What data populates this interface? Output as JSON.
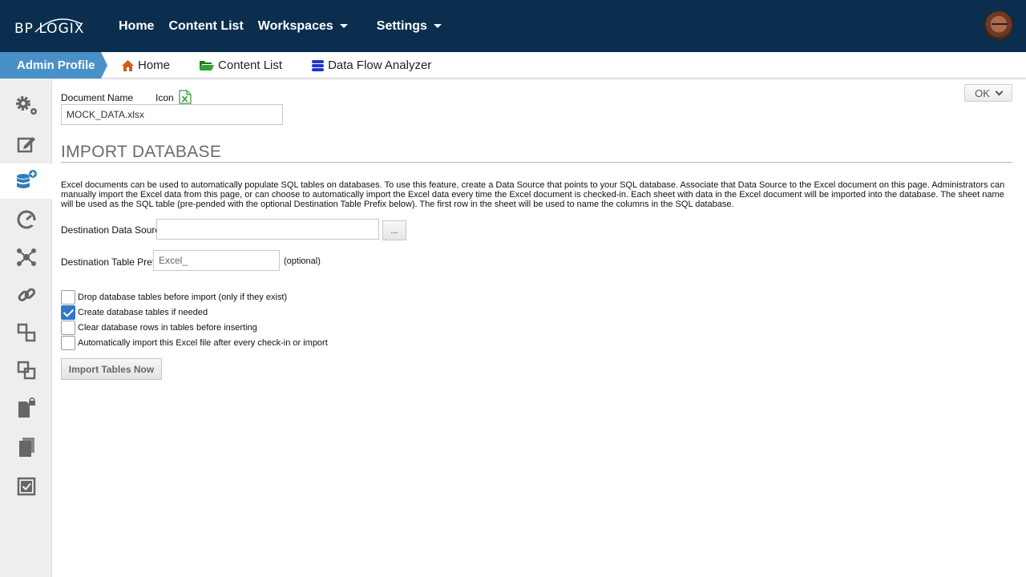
{
  "app": {
    "logo_text": "BP LOGIX",
    "top_nav": [
      {
        "label": "Home"
      },
      {
        "label": "Content List"
      },
      {
        "label": "Workspaces"
      },
      {
        "label": "Settings"
      }
    ]
  },
  "subbar": {
    "active": "Admin Profile",
    "links": [
      {
        "label": "Home",
        "icon": "house-icon",
        "color": "#c8621b"
      },
      {
        "label": "Content List",
        "icon": "folder-open-icon",
        "color": "#2a8a2a"
      },
      {
        "label": "Data Flow Analyzer",
        "icon": "database-stack-icon",
        "color": "#2233cc"
      }
    ]
  },
  "sidebar": {
    "items": [
      {
        "icon": "gears-icon"
      },
      {
        "icon": "edit-icon"
      },
      {
        "icon": "database-add-icon",
        "active": true
      },
      {
        "icon": "dashboard-gauge-icon"
      },
      {
        "icon": "network-icon"
      },
      {
        "icon": "link-icon"
      },
      {
        "icon": "dependencies-icon"
      },
      {
        "icon": "copy-link-icon"
      },
      {
        "icon": "locked-document-icon"
      },
      {
        "icon": "documents-icon"
      },
      {
        "icon": "checklist-icon"
      }
    ]
  },
  "form": {
    "document_name_label": "Document Name",
    "icon_label": "Icon",
    "document_name_value": "MOCK_DATA.xlsx",
    "ok_label": "OK",
    "section_title": "IMPORT DATABASE",
    "description": "Excel documents can be used to automatically populate SQL tables on databases. To use this feature, create a Data Source that points to your SQL database. Associate that Data Source to the Excel document on this page. Administrators can manually import the Excel data from this page, or can choose to automatically import the Excel data every time the Excel document is checked-in. Each sheet with data in the Excel document will be imported into the database. The sheet name will be used as the SQL table (pre-pended with the optional Destination Table Prefix below). The first row in the sheet will be used to name the columns in the SQL database.",
    "dest_source_label": "Destination Data Source",
    "dest_source_value": "",
    "browse_label": "...",
    "prefix_label": "Destination Table Prefix",
    "prefix_value": "Excel_",
    "optional_label": "(optional)",
    "options": [
      {
        "label": "Drop database tables before import (only if they exist)",
        "checked": false
      },
      {
        "label": "Create database tables if needed",
        "checked": true
      },
      {
        "label": "Clear database rows in tables before inserting",
        "checked": false
      },
      {
        "label": "Automatically import this Excel file after every check-in or import",
        "checked": false
      }
    ],
    "import_button": "Import Tables Now"
  }
}
